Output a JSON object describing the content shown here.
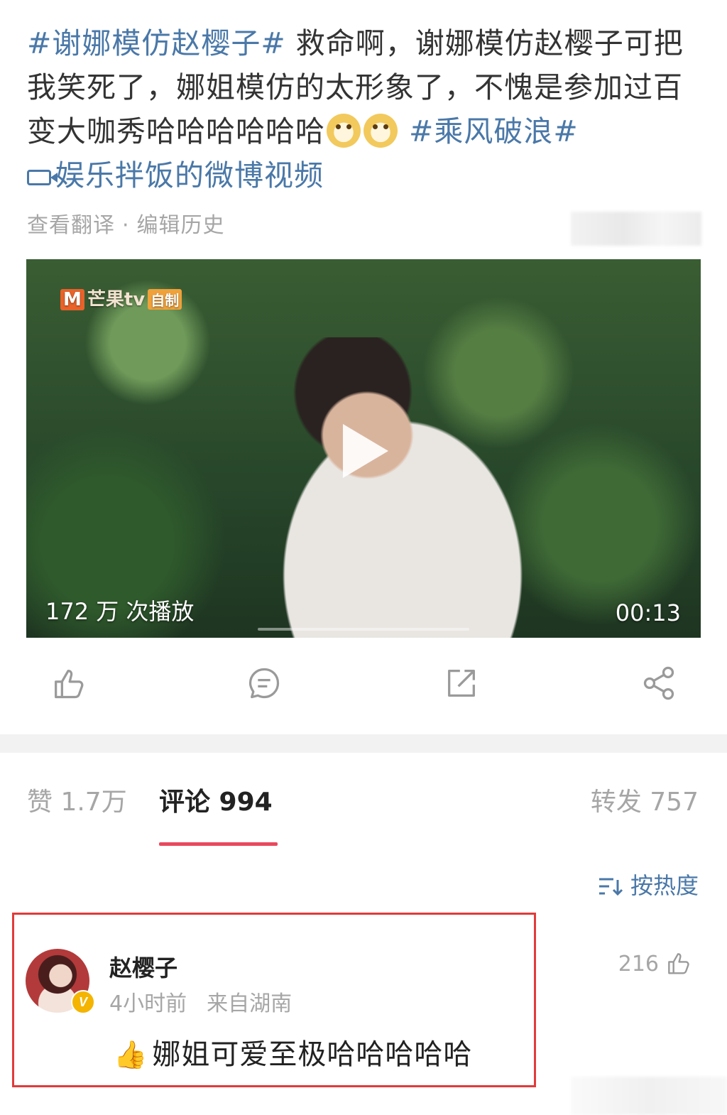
{
  "post": {
    "topic_1": "#谢娜模仿赵樱子#",
    "text_1": " 救命啊，谢娜模仿赵樱子可把我笑死了，娜姐模仿的太形象了，不愧是参加过百变大咖秀哈哈哈哈哈哈",
    "emoji_1": "doge-emoji",
    "emoji_2": "doge-emoji",
    "topic_2": "#乘风破浪#",
    "video_link": "娱乐拌饭的微博视频",
    "translate": "查看翻译",
    "separator": "·",
    "edit_history": "编辑历史"
  },
  "video": {
    "watermark_brand": "芒果tv",
    "watermark_logo": "M",
    "watermark_tag": "自制",
    "play_count": "172 万 次播放",
    "duration": "00:13"
  },
  "actions": {
    "like_icon": "thumbs-up-icon",
    "comment_icon": "comment-icon",
    "repost_icon": "repost-icon",
    "share_icon": "share-icon"
  },
  "tabs": {
    "likes": "赞 1.7万",
    "comments": "评论 994",
    "reposts": "转发 757"
  },
  "sort": {
    "label": "按热度"
  },
  "comment": {
    "author": "赵樱子",
    "verified": "V",
    "time": "4小时前",
    "location": "来自湖南",
    "likes": "216",
    "emoji": "👍",
    "text": "娜姐可爱至极哈哈哈哈哈"
  },
  "colors": {
    "link": "#4a78a8",
    "tab_underline": "#e8495e",
    "highlight_border": "#e23a3a",
    "verified_badge": "#f4b400"
  }
}
